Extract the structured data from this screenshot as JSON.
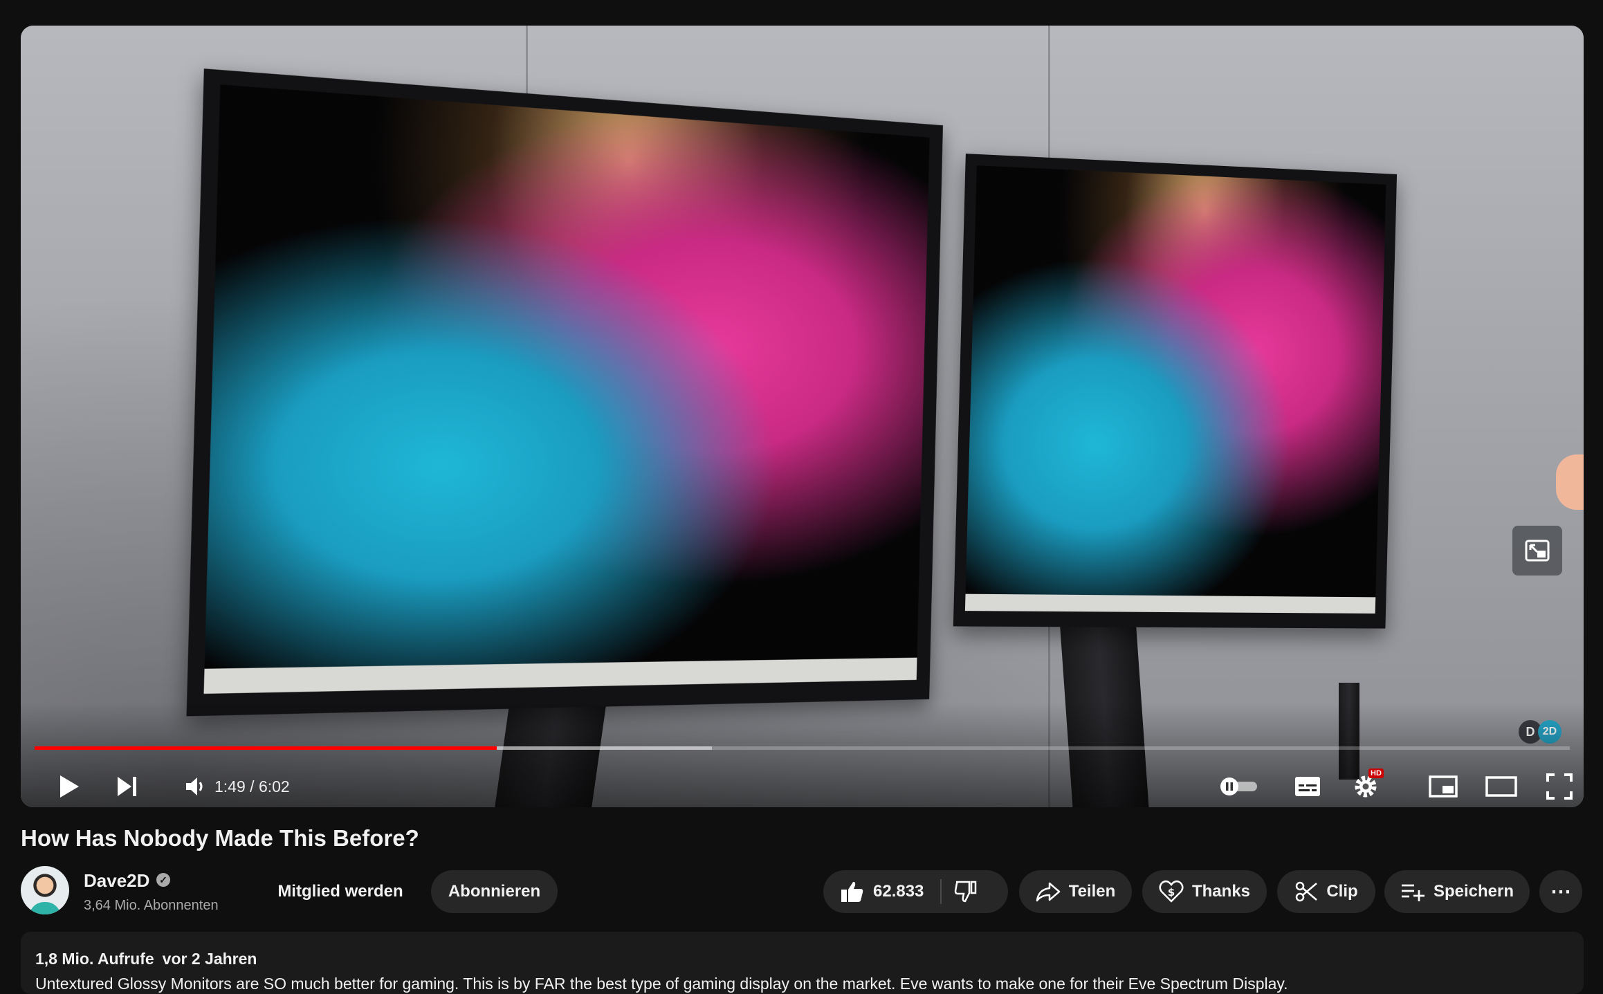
{
  "player": {
    "time_current": "1:49",
    "time_sep": " / ",
    "time_total": "6:02",
    "progress_played": 0.301,
    "progress_buffered": 0.441,
    "settings_badge": "HD",
    "watermark_left": "D",
    "watermark_right": "2D",
    "icons": [
      "play-icon",
      "next-icon",
      "volume-icon",
      "autoplay-toggle-icon",
      "subtitles-icon",
      "settings-icon",
      "miniplayer-icon",
      "theater-icon",
      "fullscreen-icon",
      "pip-expand-icon"
    ],
    "colors": {
      "progress_played": "#ff0000",
      "brand_accent": "#27a6c9"
    }
  },
  "video": {
    "title": "How Has Nobody Made This Before?",
    "channel": "Dave2D",
    "verified_icon": "✓",
    "subscribers": "3,64 Mio. Abonnenten",
    "join_label": "Mitglied werden",
    "subscribe_label": "Abonnieren",
    "likes": "62.833",
    "share_label": "Teilen",
    "thanks_label": "Thanks",
    "clip_label": "Clip",
    "save_label": "Speichern",
    "more_label": "⋯"
  },
  "description": {
    "views": "1,8 Mio. Aufrufe",
    "age": "vor 2 Jahren",
    "text": "Untextured Glossy Monitors are SO much better for gaming. This is by FAR the best type of gaming display on the market. Eve wants to make one for their Eve Spectrum Display."
  }
}
